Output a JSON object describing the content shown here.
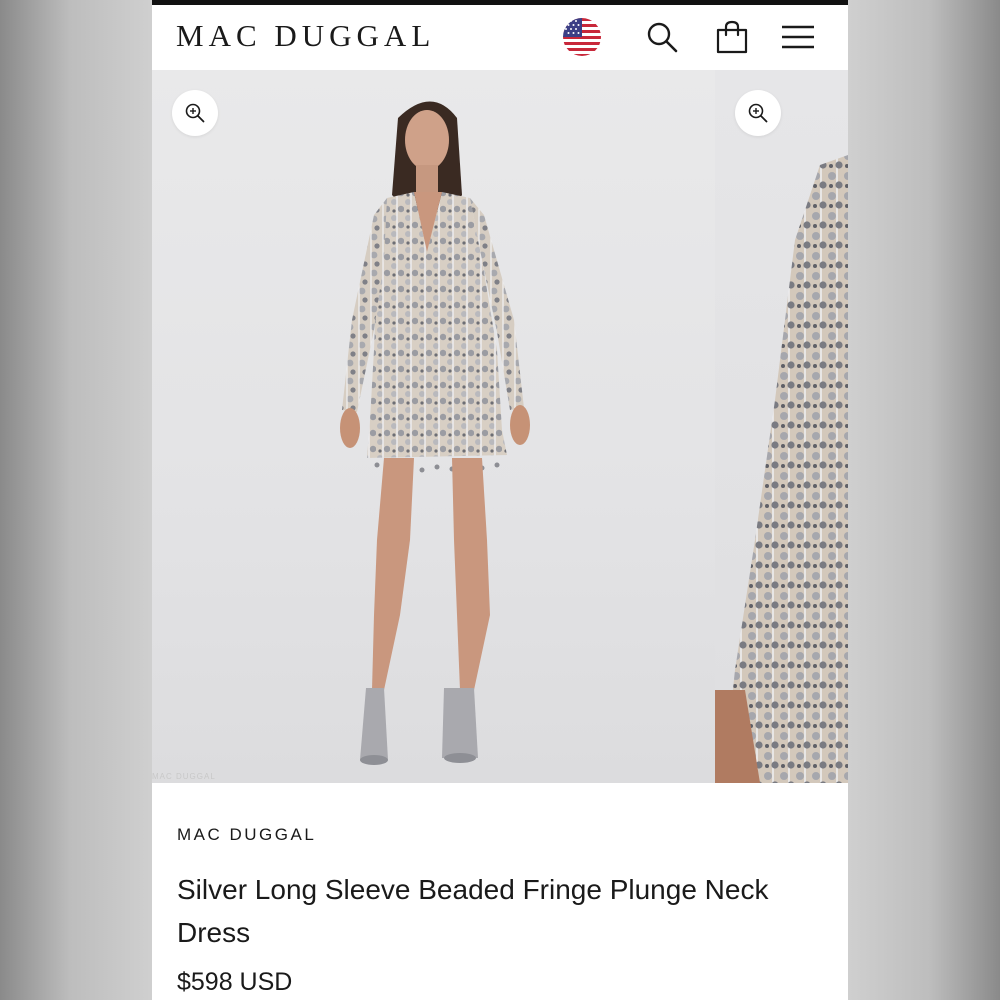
{
  "header": {
    "logo": "MAC DUGGAL",
    "icons": [
      "us-flag-icon",
      "search-icon",
      "shopping-bag-icon",
      "hamburger-menu-icon"
    ]
  },
  "gallery": {
    "watermark": "MAC DUGGAL",
    "zoom_icon": "zoom-in-icon",
    "slides": [
      {
        "name": "model front view"
      },
      {
        "name": "sleeve detail view"
      }
    ]
  },
  "product": {
    "brand": "MAC DUGGAL",
    "title": "Silver Long Sleeve Beaded Fringe Plunge Neck Dress",
    "price": "$598 USD"
  },
  "colors": {
    "text": "#1a1a1a",
    "background": "#ffffff",
    "gallery_bg": "#e6e6e8"
  }
}
